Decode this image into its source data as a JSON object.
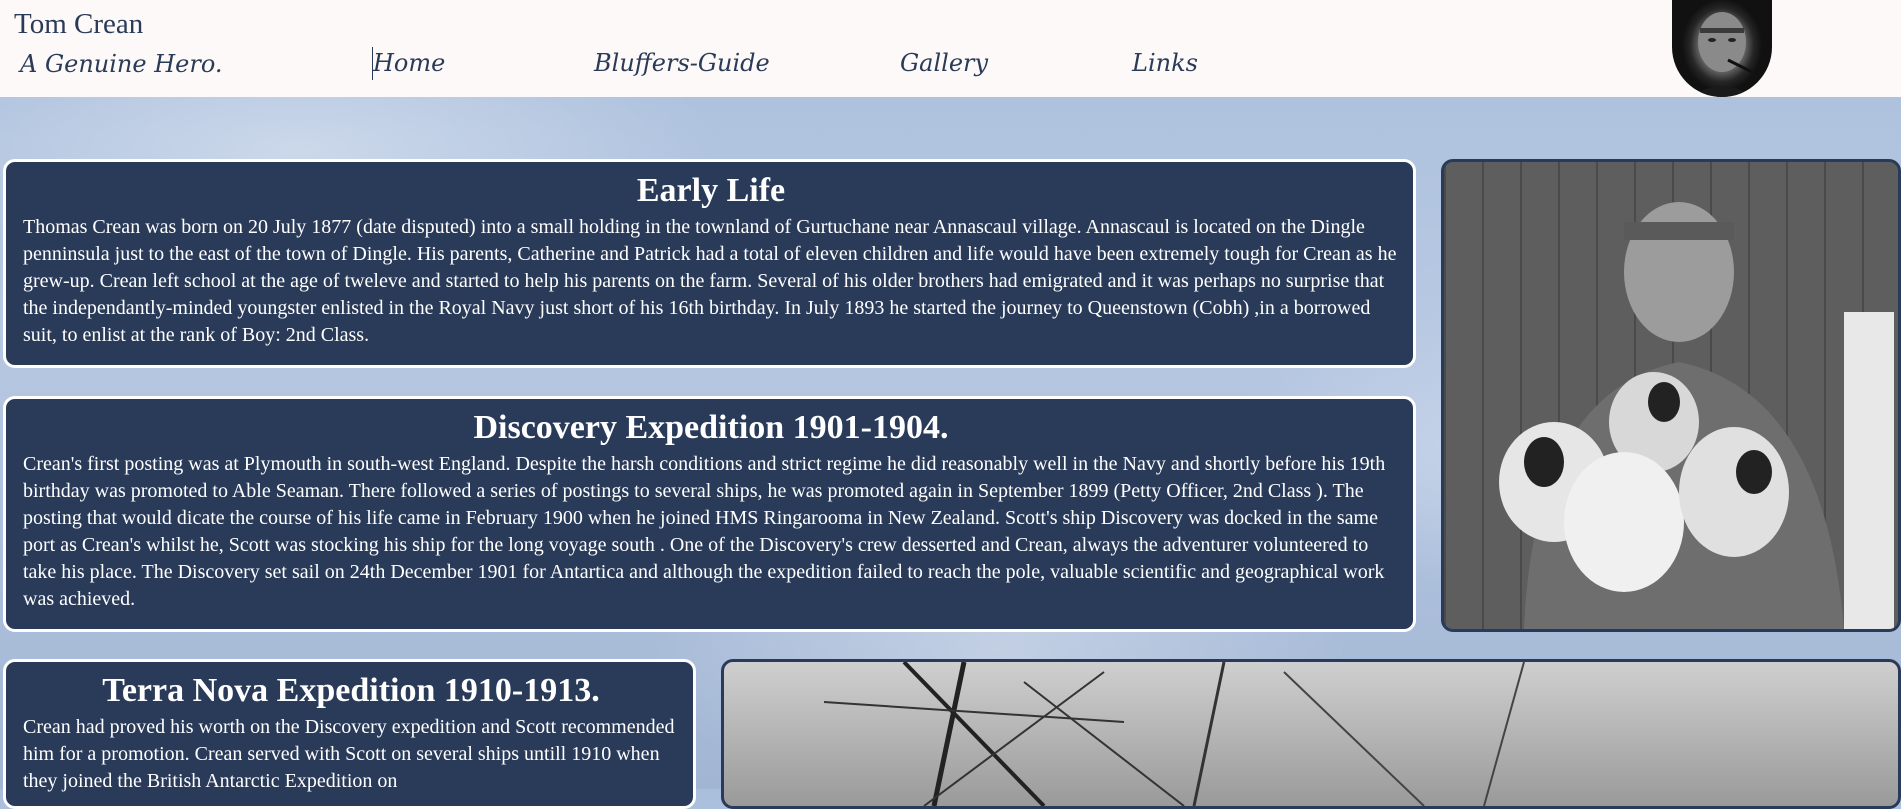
{
  "header": {
    "site_title": "Tom Crean",
    "tagline": "A Genuine Hero.",
    "nav": {
      "home": "Home",
      "bluffers": "Bluffers-Guide",
      "gallery": "Gallery",
      "links": "Links"
    }
  },
  "sections": {
    "early_life": {
      "title": "Early Life",
      "body": "Thomas Crean was born on 20 July 1877 (date disputed) into a small holding in the townland of Gurtuchane near Annascaul village. Annascaul is located on the Dingle penninsula just to the east of the town of Dingle. His parents, Catherine and Patrick had a total of eleven children and life would have been extremely tough for Crean as he grew-up. Crean left school at the age of tweleve and started to help his parents on the farm. Several of his older brothers had emigrated and it was perhaps no surprise that the independantly-minded youngster enlisted in the Royal Navy just short of his 16th birthday. In July 1893 he started the journey to Queenstown (Cobh) ,in a borrowed suit, to enlist at the rank of Boy: 2nd Class."
    },
    "discovery": {
      "title": "Discovery Expedition 1901-1904.",
      "body": "Crean's first posting was at Plymouth in south-west England. Despite the harsh conditions and strict regime he did reasonably well in the Navy and shortly before his 19th birthday was promoted to Able Seaman. There followed a series of postings to several ships, he was promoted again in September 1899 (Petty Officer, 2nd Class ). The posting that would dicate the course of his life came in February 1900 when he joined HMS Ringarooma in New Zealand. Scott's ship Discovery was docked in the same port as Crean's whilst he, Scott was stocking his ship for the long voyage south . One of the Discovery's crew desserted and Crean, always the adventurer volunteered to take his place. The Discovery set sail on 24th December 1901 for Antartica and although the expedition failed to reach the pole, valuable scientific and geographical work was achieved."
    },
    "terra_nova": {
      "title": "Terra Nova Expedition 1910-1913.",
      "body": "Crean had proved his worth on the Discovery expedition and Scott recommended him for a promotion. Crean served with Scott on several ships untill 1910 when they joined the British Antarctic Expedition on"
    }
  }
}
